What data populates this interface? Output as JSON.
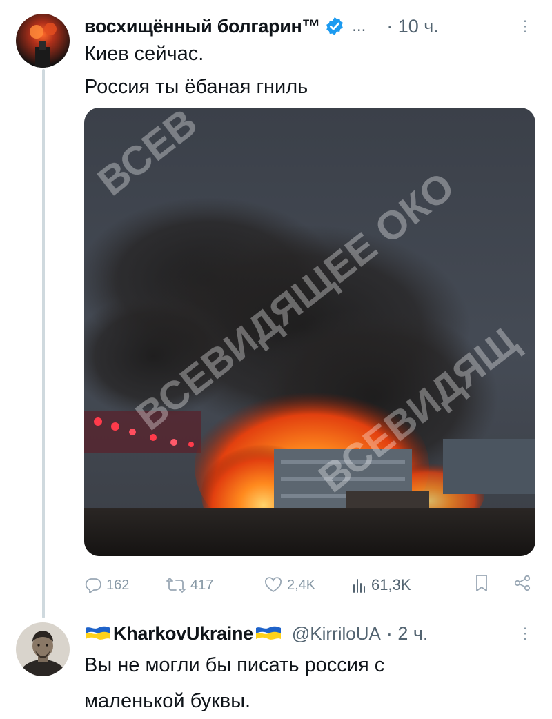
{
  "tweet1": {
    "author_name": "восхищённый болгарин™",
    "more_dots": "...",
    "time": "· 10 ч.",
    "lines": [
      "Киев сейчас.",
      "Россия ты ёбаная гниль"
    ],
    "watermark": "ВСЕВИДЯЩЕЕ ОКО",
    "actions": {
      "replies": "162",
      "retweets": "417",
      "likes": "2,4K",
      "views": "61,3K"
    }
  },
  "tweet2": {
    "author_name": "KharkovUkraine",
    "handle": "@KirriloUA",
    "time": "· 2 ч.",
    "lines": [
      "Вы не могли бы писать россия с",
      "маленькой буквы."
    ]
  },
  "colors": {
    "accent": "#1d9bf0",
    "muted": "#536471",
    "line": "#cfd9de"
  },
  "icons": [
    "verified-badge-icon",
    "more-icon",
    "reply-icon",
    "retweet-icon",
    "like-icon",
    "views-icon",
    "bookmark-icon",
    "share-icon",
    "ukraine-flag-icon"
  ]
}
